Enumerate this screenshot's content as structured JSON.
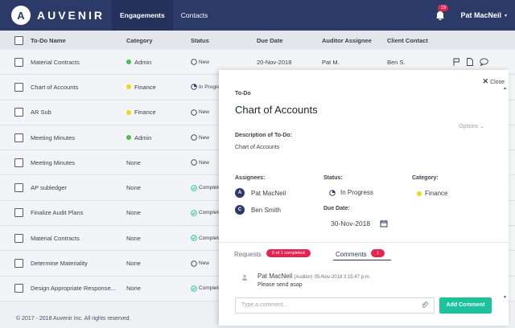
{
  "topbar": {
    "logo_letter": "A",
    "logo_text": "AUVENIR",
    "tabs": [
      {
        "label": "Engagements",
        "active": true
      },
      {
        "label": "Contacts",
        "active": false
      }
    ],
    "notification_count": "19",
    "user_name": "Pat MacNeil"
  },
  "table": {
    "headers": {
      "name": "To-Do Name",
      "category": "Category",
      "status": "Status",
      "due": "Due Date",
      "auditor": "Auditor Assignee",
      "client": "Client Contact"
    },
    "rows": [
      {
        "name": "Material Contracts",
        "category": "Admin",
        "cat_color": "#4cbf4c",
        "status": "New",
        "status_icon": "circle-empty",
        "due": "20-Nov-2018",
        "auditor": "Pat M.",
        "client": "Ben S."
      },
      {
        "name": "Chart of Accounts",
        "category": "Finance",
        "cat_color": "#ecd81e",
        "status": "In Progres",
        "status_icon": "circle-partial",
        "due": "",
        "auditor": "",
        "client": ""
      },
      {
        "name": "AR Sub",
        "category": "Finance",
        "cat_color": "#ecd81e",
        "status": "New",
        "status_icon": "circle-empty",
        "due": "",
        "auditor": "",
        "client": ""
      },
      {
        "name": "Meeting Minutes",
        "category": "Admin",
        "cat_color": "#4cbf4c",
        "status": "New",
        "status_icon": "circle-empty",
        "due": "",
        "auditor": "",
        "client": ""
      },
      {
        "name": "Meeting Minutes",
        "category": "None",
        "cat_color": "",
        "status": "New",
        "status_icon": "circle-empty",
        "due": "",
        "auditor": "",
        "client": ""
      },
      {
        "name": "AP subledger",
        "category": "None",
        "cat_color": "",
        "status": "Complete",
        "status_icon": "check-circle",
        "due": "",
        "auditor": "",
        "client": ""
      },
      {
        "name": "Finalize Audit Plans",
        "category": "None",
        "cat_color": "",
        "status": "Complete",
        "status_icon": "check-circle",
        "due": "",
        "auditor": "",
        "client": ""
      },
      {
        "name": "Material Contracts",
        "category": "None",
        "cat_color": "",
        "status": "Complete",
        "status_icon": "check-circle",
        "due": "",
        "auditor": "",
        "client": ""
      },
      {
        "name": "Determine Materiality",
        "category": "None",
        "cat_color": "",
        "status": "New",
        "status_icon": "circle-empty",
        "due": "",
        "auditor": "",
        "client": ""
      },
      {
        "name": "Design Appropriate Response...",
        "category": "None",
        "cat_color": "",
        "status": "Complete",
        "status_icon": "check-circle",
        "due": "",
        "auditor": "",
        "client": ""
      }
    ],
    "row_icons": [
      "flag-icon",
      "document-icon",
      "comment-icon"
    ]
  },
  "footer": {
    "text": "© 2017 - 2018 Auvenir Inc. All rights reserved."
  },
  "panel": {
    "close_label": "Close",
    "section_label": "To-Do",
    "title": "Chart of Accounts",
    "options_label": "Options",
    "description_label": "Description of To-Do:",
    "description": "Chart of Accounts",
    "assignees_label": "Assignees:",
    "assignees": [
      {
        "initial": "A",
        "name": "Pat MacNeil"
      },
      {
        "initial": "C",
        "name": "Ben Smith"
      }
    ],
    "status_label": "Status:",
    "status_value": "In Progress",
    "category_label": "Category:",
    "category_value": "Finance",
    "category_color": "#ecd81e",
    "due_label": "Due Date:",
    "due_value": "30-Nov-2018",
    "requests_label": "Requests",
    "requests_badge": "0 of 1 completed",
    "comments_label": "Comments",
    "comments_badge": "1",
    "comment": {
      "author": "Pat MacNeil",
      "role": "(Auditor)",
      "timestamp": "05-Nov-2018 3:15:47 p.m.",
      "text": "Please send asap"
    },
    "input_placeholder": "Type a comment...",
    "add_button": "Add Comment"
  },
  "colors": {
    "brand": "#2b3a67",
    "accent_red": "#e5254f",
    "accent_green": "#19c39c"
  }
}
